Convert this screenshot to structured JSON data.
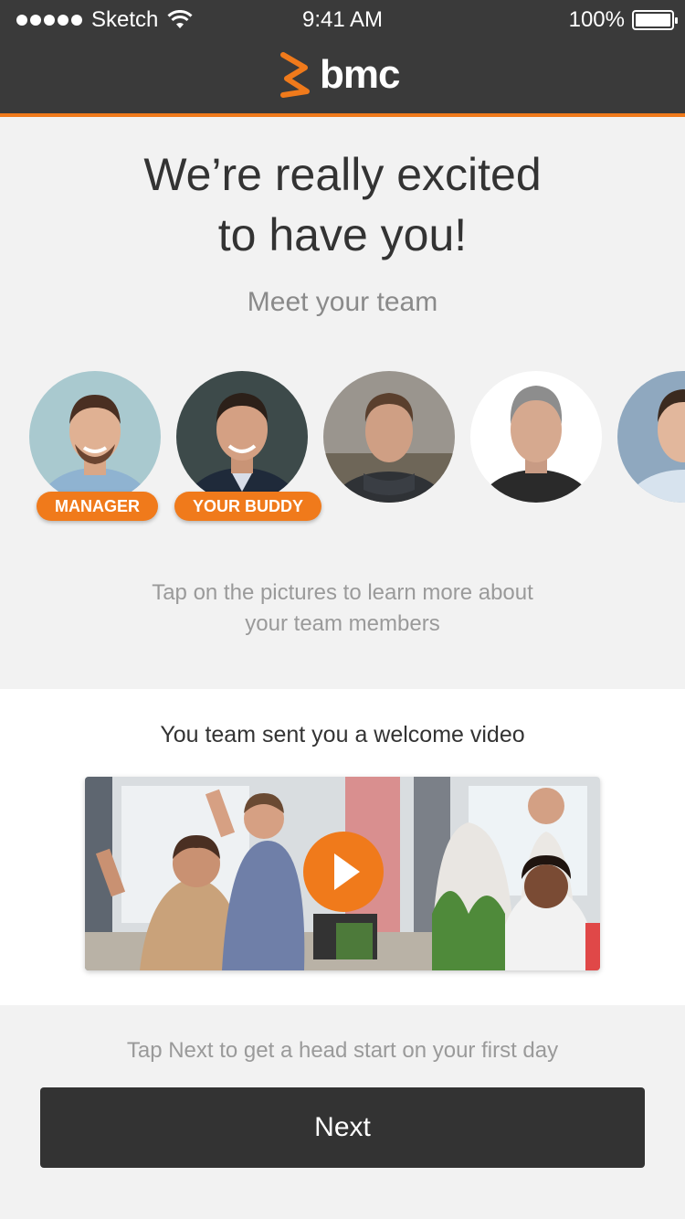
{
  "status_bar": {
    "carrier": "Sketch",
    "time": "9:41 AM",
    "battery_percent": "100%",
    "signal_dots": 5,
    "battery_level": 1.0
  },
  "header": {
    "logo_text": "bmc",
    "accent_color": "#f07a1b",
    "background_color": "#3a3a3a"
  },
  "hero": {
    "title_line1": "We’re really excited",
    "title_line2": "to have you!",
    "subtitle": "Meet your team"
  },
  "team": {
    "members": [
      {
        "badge": "MANAGER"
      },
      {
        "badge": "YOUR BUDDY"
      },
      {
        "badge": ""
      },
      {
        "badge": ""
      },
      {
        "badge": ""
      }
    ],
    "hint_line1": "Tap on the pictures to learn more about",
    "hint_line2": "your team members"
  },
  "video": {
    "title": "You team sent you a welcome video",
    "play_icon": "play-icon"
  },
  "footer": {
    "hint": "Tap Next to get a head start on your first day",
    "next_label": "Next"
  }
}
